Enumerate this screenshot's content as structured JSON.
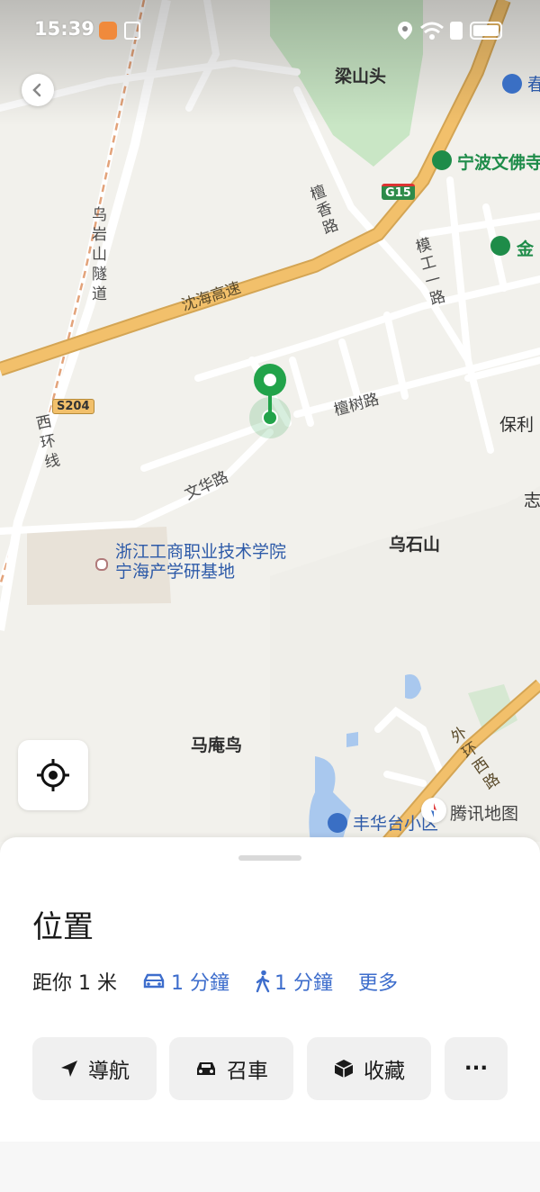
{
  "status_bar": {
    "time": "15:39"
  },
  "map": {
    "labels": {
      "liangshantou": "梁山头",
      "chun": "春",
      "ningbo_wenfo": "宁波文佛寺",
      "jin": "金",
      "g15": "G15",
      "s204": "S204",
      "tanxiang_road": "檀香路",
      "wuyanshan_tunnel": "乌岩山隧道",
      "shenhai_expressway": "沈海高速",
      "mogong_road": "模工一路",
      "tanshu_road": "檀树路",
      "xihuan_line": "西环线",
      "wenhua_road": "文华路",
      "baoli": "保利",
      "zhi": "志",
      "zhejiang_college": "浙江工商职业技术学院宁海产学研基地",
      "wushishan": "乌石山",
      "maanniao": "马庵鸟",
      "waihuan_xi_road": "外环西路",
      "fenghua_community": "丰华台小区",
      "tencent_map": "腾讯地图"
    },
    "colors": {
      "green_area": "#c9e6c5",
      "expressway": "#f2c06b",
      "marker": "#22a34a",
      "poi_blue": "#2d5aa8"
    }
  },
  "sheet": {
    "title": "位置",
    "distance": "距你 1 米",
    "drive_time": "1 分鐘",
    "walk_time": "1 分鐘",
    "more": "更多",
    "buttons": {
      "navigate": "導航",
      "taxi": "召車",
      "favorite": "收藏",
      "more_icon": "···"
    }
  }
}
